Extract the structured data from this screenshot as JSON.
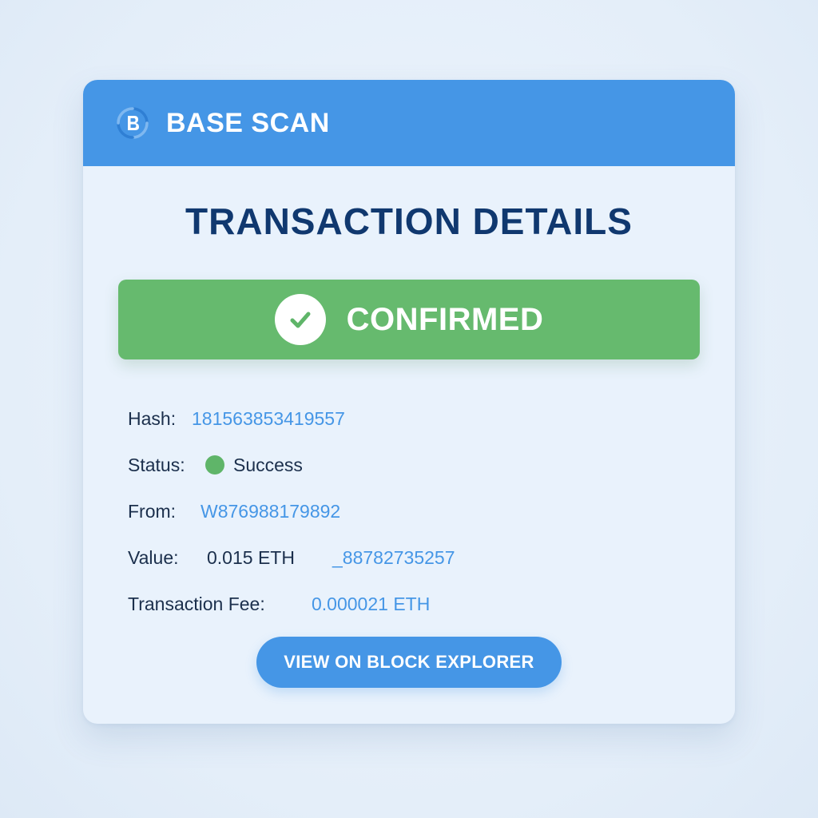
{
  "header": {
    "brand": "BASE SCAN",
    "logo_icon": "base-logo-icon"
  },
  "title": "TRANSACTION DETAILS",
  "banner": {
    "label": "CONFIRMED",
    "icon": "check-circle-icon",
    "color": "#66ba6e"
  },
  "details": {
    "hash": {
      "label": "Hash:",
      "value": "181563853419557"
    },
    "status": {
      "label": "Status:",
      "value": "Success",
      "indicator_color": "#5fb569"
    },
    "from": {
      "label": "From:",
      "value": "W876988179892"
    },
    "value": {
      "label": "Value:",
      "amount": "0.015 ETH",
      "extra": "_88782735257"
    },
    "fee": {
      "label": "Transaction Fee:",
      "value": "0.000021 ETH"
    }
  },
  "actions": {
    "explorer_button": "VIEW ON BLOCK EXPLORER"
  },
  "colors": {
    "accent": "#4596e6",
    "title": "#10386f",
    "success": "#66ba6e"
  }
}
